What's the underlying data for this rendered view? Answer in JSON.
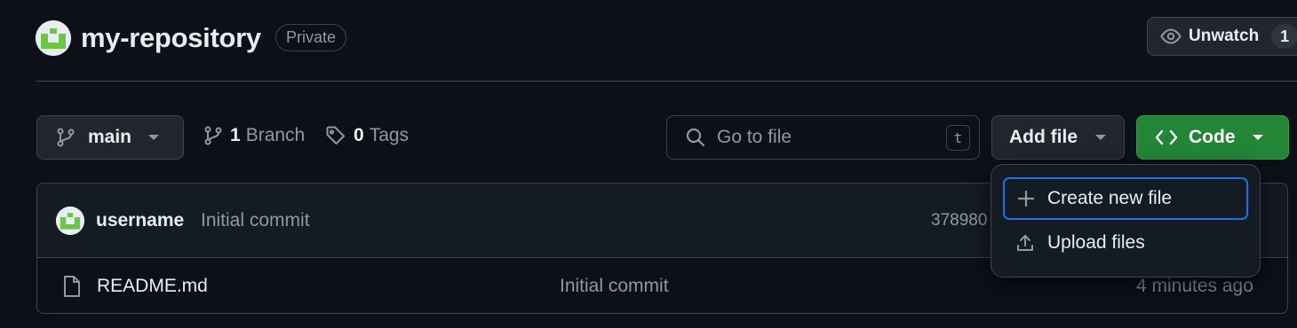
{
  "repo": {
    "name": "my-repository",
    "visibility": "Private",
    "watch_label": "Unwatch",
    "watch_count": "1"
  },
  "toolbar": {
    "branch": "main",
    "branch_count": "1",
    "branch_label": "Branch",
    "tag_count": "0",
    "tag_label": "Tags",
    "search_placeholder": "Go to file",
    "search_shortcut": "t",
    "add_file_label": "Add file",
    "code_label": "Code"
  },
  "latest_commit": {
    "author": "username",
    "message": "Initial commit",
    "hash": "378980"
  },
  "files": [
    {
      "name": "README.md",
      "commit_message": "Initial commit",
      "updated": "4 minutes ago"
    }
  ],
  "add_file_menu": {
    "items": [
      {
        "label": "Create new file",
        "icon": "plus-icon"
      },
      {
        "label": "Upload files",
        "icon": "upload-icon"
      }
    ]
  },
  "colors": {
    "background": "#0d1117",
    "code_button": "#238636",
    "focus_ring": "#1f6feb",
    "avatar_identicon": "#6cc644"
  }
}
